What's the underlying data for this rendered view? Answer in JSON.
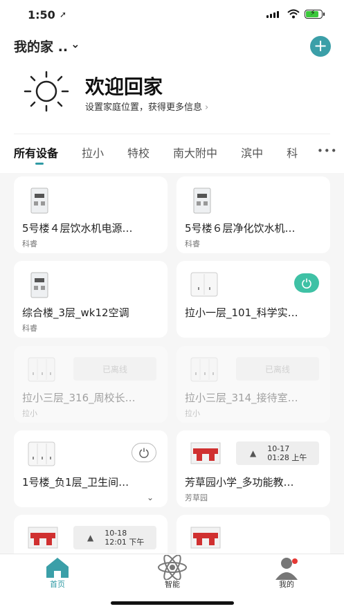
{
  "status": {
    "time": "1:50",
    "location_arrow": "➚"
  },
  "header": {
    "home_name": "我的家 ..",
    "caret": "⌄",
    "add": "+"
  },
  "welcome": {
    "title": "欢迎回家",
    "subtitle": "设置家庭位置，获得更多信息",
    "arrow": "›"
  },
  "tabs": {
    "items": [
      "所有设备",
      "拉小",
      "特校",
      "南大附中",
      "滨中",
      "科"
    ],
    "more": "•••"
  },
  "cards": [
    {
      "name": "5号楼４层饮水机电源…",
      "brand": "科睿"
    },
    {
      "name": "5号楼６层净化饮水机…",
      "brand": "科睿"
    },
    {
      "name": "综合楼_3层_wk12空调",
      "brand": "科睿"
    },
    {
      "name": "拉小一层_101_科学实…",
      "brand": ""
    },
    {
      "name": "拉小三层_316_周校长…",
      "brand": "拉小",
      "status": "已离线"
    },
    {
      "name": "拉小三层_314_接待室…",
      "brand": "拉小",
      "status": "已离线"
    },
    {
      "name": "1号楼_负1层_卫生间…",
      "brand": ""
    },
    {
      "name": "芳草园小学_多功能教…",
      "brand": "芳草园",
      "alarm_date": "10-17",
      "alarm_time": "01:28 上午"
    },
    {
      "name": "",
      "brand": "",
      "alarm_date": "10-18",
      "alarm_time": "12:01 下午"
    },
    {
      "name": "",
      "brand": ""
    }
  ],
  "nav": {
    "home": "首页",
    "smart": "智能",
    "mine": "我的"
  },
  "colors": {
    "accent": "#2f9aa4",
    "power_on": "#3fc1a5",
    "breaker_red": "#d03030"
  }
}
